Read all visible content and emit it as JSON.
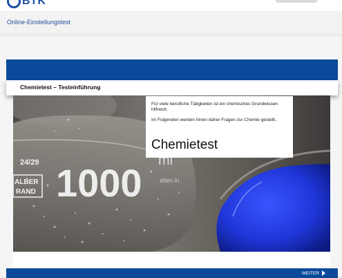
{
  "header": {
    "logo_text": "BTK"
  },
  "breadcrumb": {
    "label": "Online-Einstellungstest"
  },
  "section": {
    "title": "Chemietest – Testeinführung"
  },
  "intro": {
    "paragraph_1": "Für viele berufliche Tätigkeiten ist ein chemisches Grundwissen hilfreich.",
    "paragraph_2": "Im Folgenden werden Ihnen daher Fragen zur Chemie gestellt.",
    "heading": "Chemietest"
  },
  "photo": {
    "beaker_volume": "1000",
    "beaker_unit": "ml",
    "beaker_joint": "24/29",
    "beaker_brand_1": "ALBER",
    "beaker_brand_2": "RAND",
    "beaker_small": "allen in"
  },
  "navigation": {
    "next_label": "WEITER",
    "next_icon": "play-arrow-icon"
  },
  "colors": {
    "brand_blue": "#0b4a9a",
    "liquid_blue": "#1f36d8"
  }
}
